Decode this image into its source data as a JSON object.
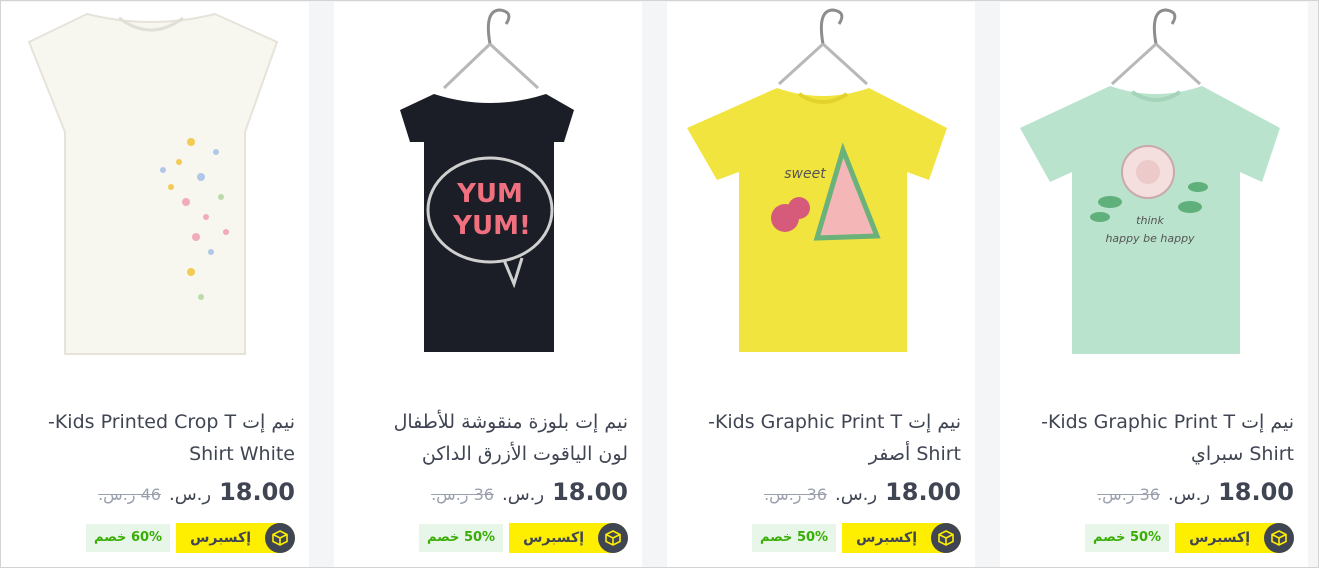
{
  "products": [
    {
      "title_line1": "نيم إت Kids Printed Crop T-",
      "title_line2": "Shirt White",
      "price": "18.00",
      "currency": "ر.س.",
      "old_price": "46 ر.س.",
      "express_label": "إكسبرس",
      "discount": "60% خصم",
      "shirt_color": "#f7f6ef"
    },
    {
      "title_line1": "نيم إت بلوزة منقوشة للأطفال",
      "title_line2": "لون الياقوت الأزرق الداكن",
      "price": "18.00",
      "currency": "ر.س.",
      "old_price": "36 ر.س.",
      "express_label": "إكسبرس",
      "discount": "50% خصم",
      "shirt_color": "#1b1e26"
    },
    {
      "title_line1": "نيم إت Kids Graphic Print T-",
      "title_line2": "Shirt أصفر",
      "price": "18.00",
      "currency": "ر.س.",
      "old_price": "36 ر.س.",
      "express_label": "إكسبرس",
      "discount": "50% خصم",
      "shirt_color": "#f2e43f"
    },
    {
      "title_line1": "نيم إت Kids Graphic Print T-",
      "title_line2": "Shirt سبراي",
      "price": "18.00",
      "currency": "ر.س.",
      "old_price": "36 ر.س.",
      "express_label": "إكسبرس",
      "discount": "50% خصم",
      "shirt_color": "#b9e3cc"
    }
  ],
  "graphics": {
    "card2_print": "yum yum!",
    "card3_print": "sweet",
    "card4_print_line1": "think",
    "card4_print_line2": "happy be happy"
  },
  "colors": {
    "express_yellow": "#feee00",
    "discount_green": "#38ae04",
    "discount_bg": "#e8f5e9",
    "text_dark": "#404553",
    "muted": "#9aa0ad"
  },
  "icons": {
    "express_badge": "box-icon"
  }
}
